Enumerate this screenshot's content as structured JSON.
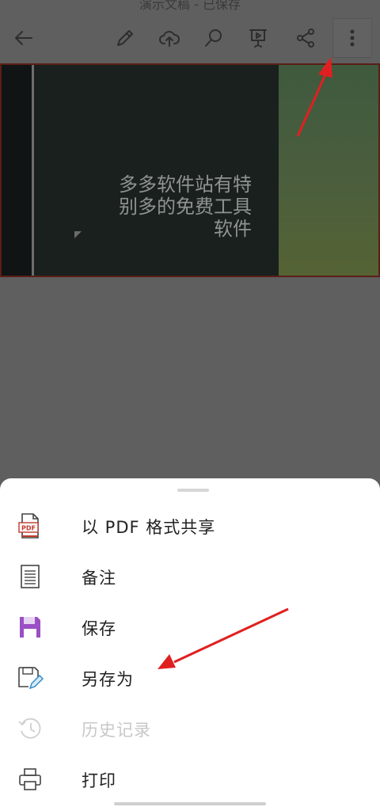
{
  "app": {
    "title": "演示文稿 - 已保存"
  },
  "toolbar": {
    "back_icon": "arrow-left-icon",
    "edit_icon": "pencil-icon",
    "upload_icon": "cloud-upload-icon",
    "search_icon": "search-icon",
    "present_icon": "presentation-icon",
    "share_icon": "share-icon",
    "more_icon": "more-vertical-icon"
  },
  "slide": {
    "text": "多多软件站有特别多的免费工具软件",
    "line1": "多多软件站有特",
    "line2": "别多的免费工具",
    "line3": "软件"
  },
  "menu": {
    "items": [
      {
        "label": "以 PDF 格式共享",
        "icon": "pdf-file-icon",
        "enabled": true
      },
      {
        "label": "备注",
        "icon": "notes-icon",
        "enabled": true
      },
      {
        "label": "保存",
        "icon": "save-icon",
        "enabled": true
      },
      {
        "label": "另存为",
        "icon": "save-as-icon",
        "enabled": true
      },
      {
        "label": "历史记录",
        "icon": "history-icon",
        "enabled": false
      },
      {
        "label": "打印",
        "icon": "printer-icon",
        "enabled": true
      }
    ]
  },
  "colors": {
    "overlay": "#5f5f5f",
    "sheet": "#ffffff",
    "pdf_accent": "#c0392b",
    "save_purple": "#9b4fc4",
    "annotation_arrow": "#e02020"
  }
}
